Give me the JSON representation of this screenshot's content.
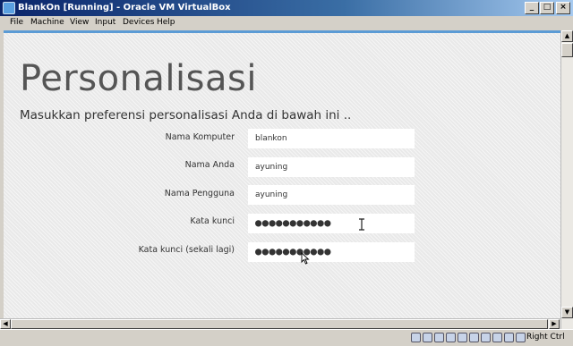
{
  "window": {
    "title": "BlankOn [Running] - Oracle VM VirtualBox",
    "buttons": [
      "_",
      "□",
      "×"
    ]
  },
  "menu": {
    "items": [
      "File",
      "Machine",
      "View",
      "Input",
      "Devices",
      "Help"
    ]
  },
  "guest": {
    "page_title": "Personalisasi",
    "subtitle": "Masukkan preferensi personalisasi Anda di bawah ini ..",
    "fields": [
      {
        "label": "Nama Komputer",
        "value": "blankon"
      },
      {
        "label": "Nama Anda",
        "value": "ayuning"
      },
      {
        "label": "Nama Pengguna",
        "value": "ayuning"
      },
      {
        "label": "Kata kunci",
        "value": "●●●●●●●●●●●"
      },
      {
        "label": "Kata kunci (sekali lagi)",
        "value": "●●●●●●●●●●●"
      }
    ]
  },
  "status": {
    "host_key": "Right Ctrl"
  },
  "colors": {
    "accent": "#5b9bd5",
    "titlebar": "#0a246a"
  }
}
